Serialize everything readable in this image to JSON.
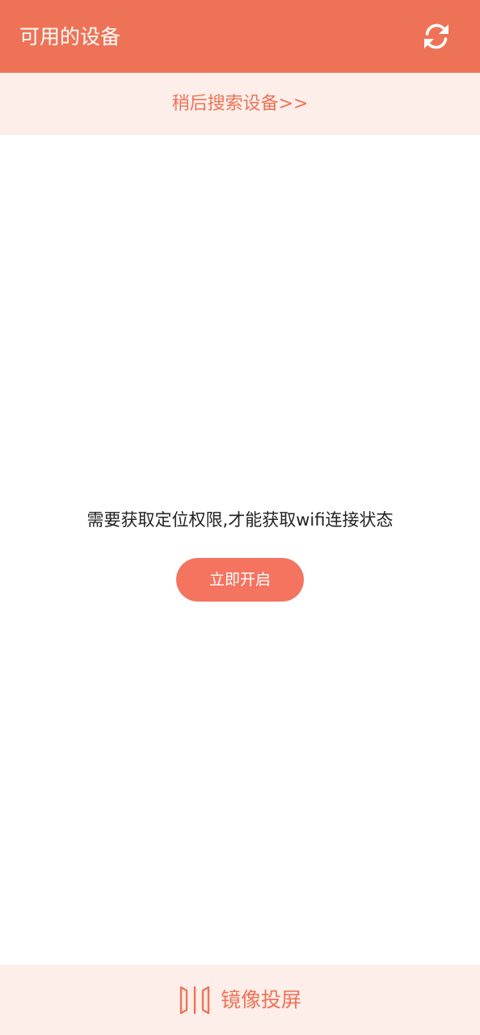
{
  "header": {
    "title": "可用的设备",
    "refresh_icon": "refresh-icon"
  },
  "search_later": {
    "label": "稍后搜索设备>>"
  },
  "permission": {
    "message": "需要获取定位权限,才能获取wifi连接状态",
    "button_label": "立即开启"
  },
  "bottom_bar": {
    "icon": "mirror-screen-icon",
    "label": "镜像投屏"
  },
  "colors": {
    "brand": "#EE7356",
    "button": "#F47460",
    "light_bg": "#FEEEEA",
    "text_dark": "#222222",
    "white": "#FFFFFF"
  }
}
